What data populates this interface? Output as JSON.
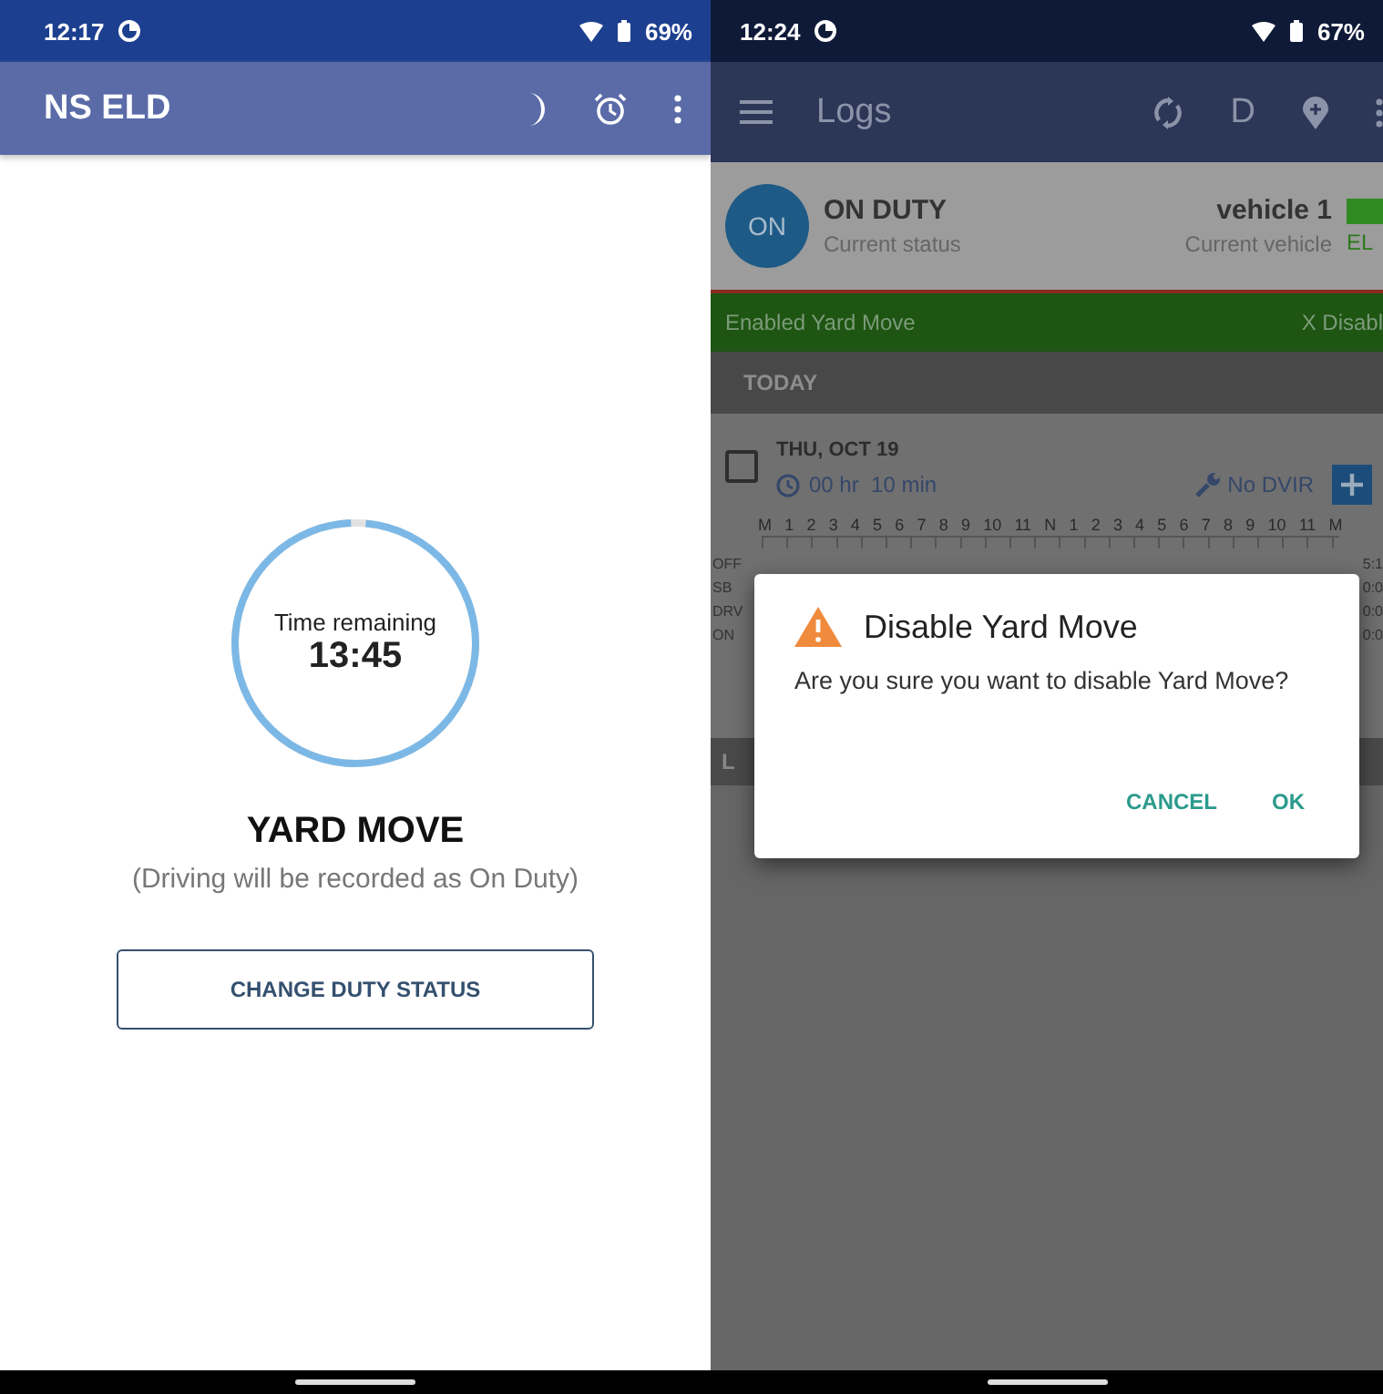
{
  "left_screen": {
    "status_bar": {
      "time": "12:17",
      "battery": "69%"
    },
    "app_bar": {
      "title": "NS ELD"
    },
    "timer": {
      "label": "Time remaining",
      "value": "13:45",
      "level": 0.98
    },
    "mode_title": "YARD MOVE",
    "mode_note": "(Driving will be recorded as On Duty)",
    "buttons": [
      "CHANGE DUTY STATUS"
    ]
  },
  "right_screen": {
    "status_bar": {
      "time": "12:24",
      "battery": "67%"
    },
    "app_bar": {
      "title": "Logs",
      "action_label": "D"
    },
    "status_card": {
      "badge": "ON",
      "status": "ON DUTY",
      "status_caption": "Current status",
      "vehicle": "vehicle 1",
      "vehicle_caption": "Current vehicle",
      "eld_label": "EL"
    },
    "banner": {
      "text": "Enabled Yard Move",
      "action": "X Disabl"
    },
    "section_header": "TODAY",
    "log_day": {
      "date": "THU, OCT 19",
      "checked": false,
      "duration": "00 hr  10 min",
      "dvir": "No DVIR",
      "hours": [
        "M",
        "1",
        "2",
        "3",
        "4",
        "5",
        "6",
        "7",
        "8",
        "9",
        "10",
        "11",
        "N",
        "1",
        "2",
        "3",
        "4",
        "5",
        "6",
        "7",
        "8",
        "9",
        "10",
        "11",
        "M"
      ],
      "rows": [
        {
          "label": "OFF",
          "total": "5:1"
        },
        {
          "label": "SB",
          "total": "0:0"
        },
        {
          "label": "DRV",
          "total": "0:0"
        },
        {
          "label": "ON",
          "total": "0:0"
        }
      ]
    },
    "next_section_header": "L",
    "dialog": {
      "title": "Disable Yard Move",
      "message": "Are you sure you want to disable Yard Move?",
      "buttons": [
        "CANCEL",
        "OK"
      ]
    }
  }
}
